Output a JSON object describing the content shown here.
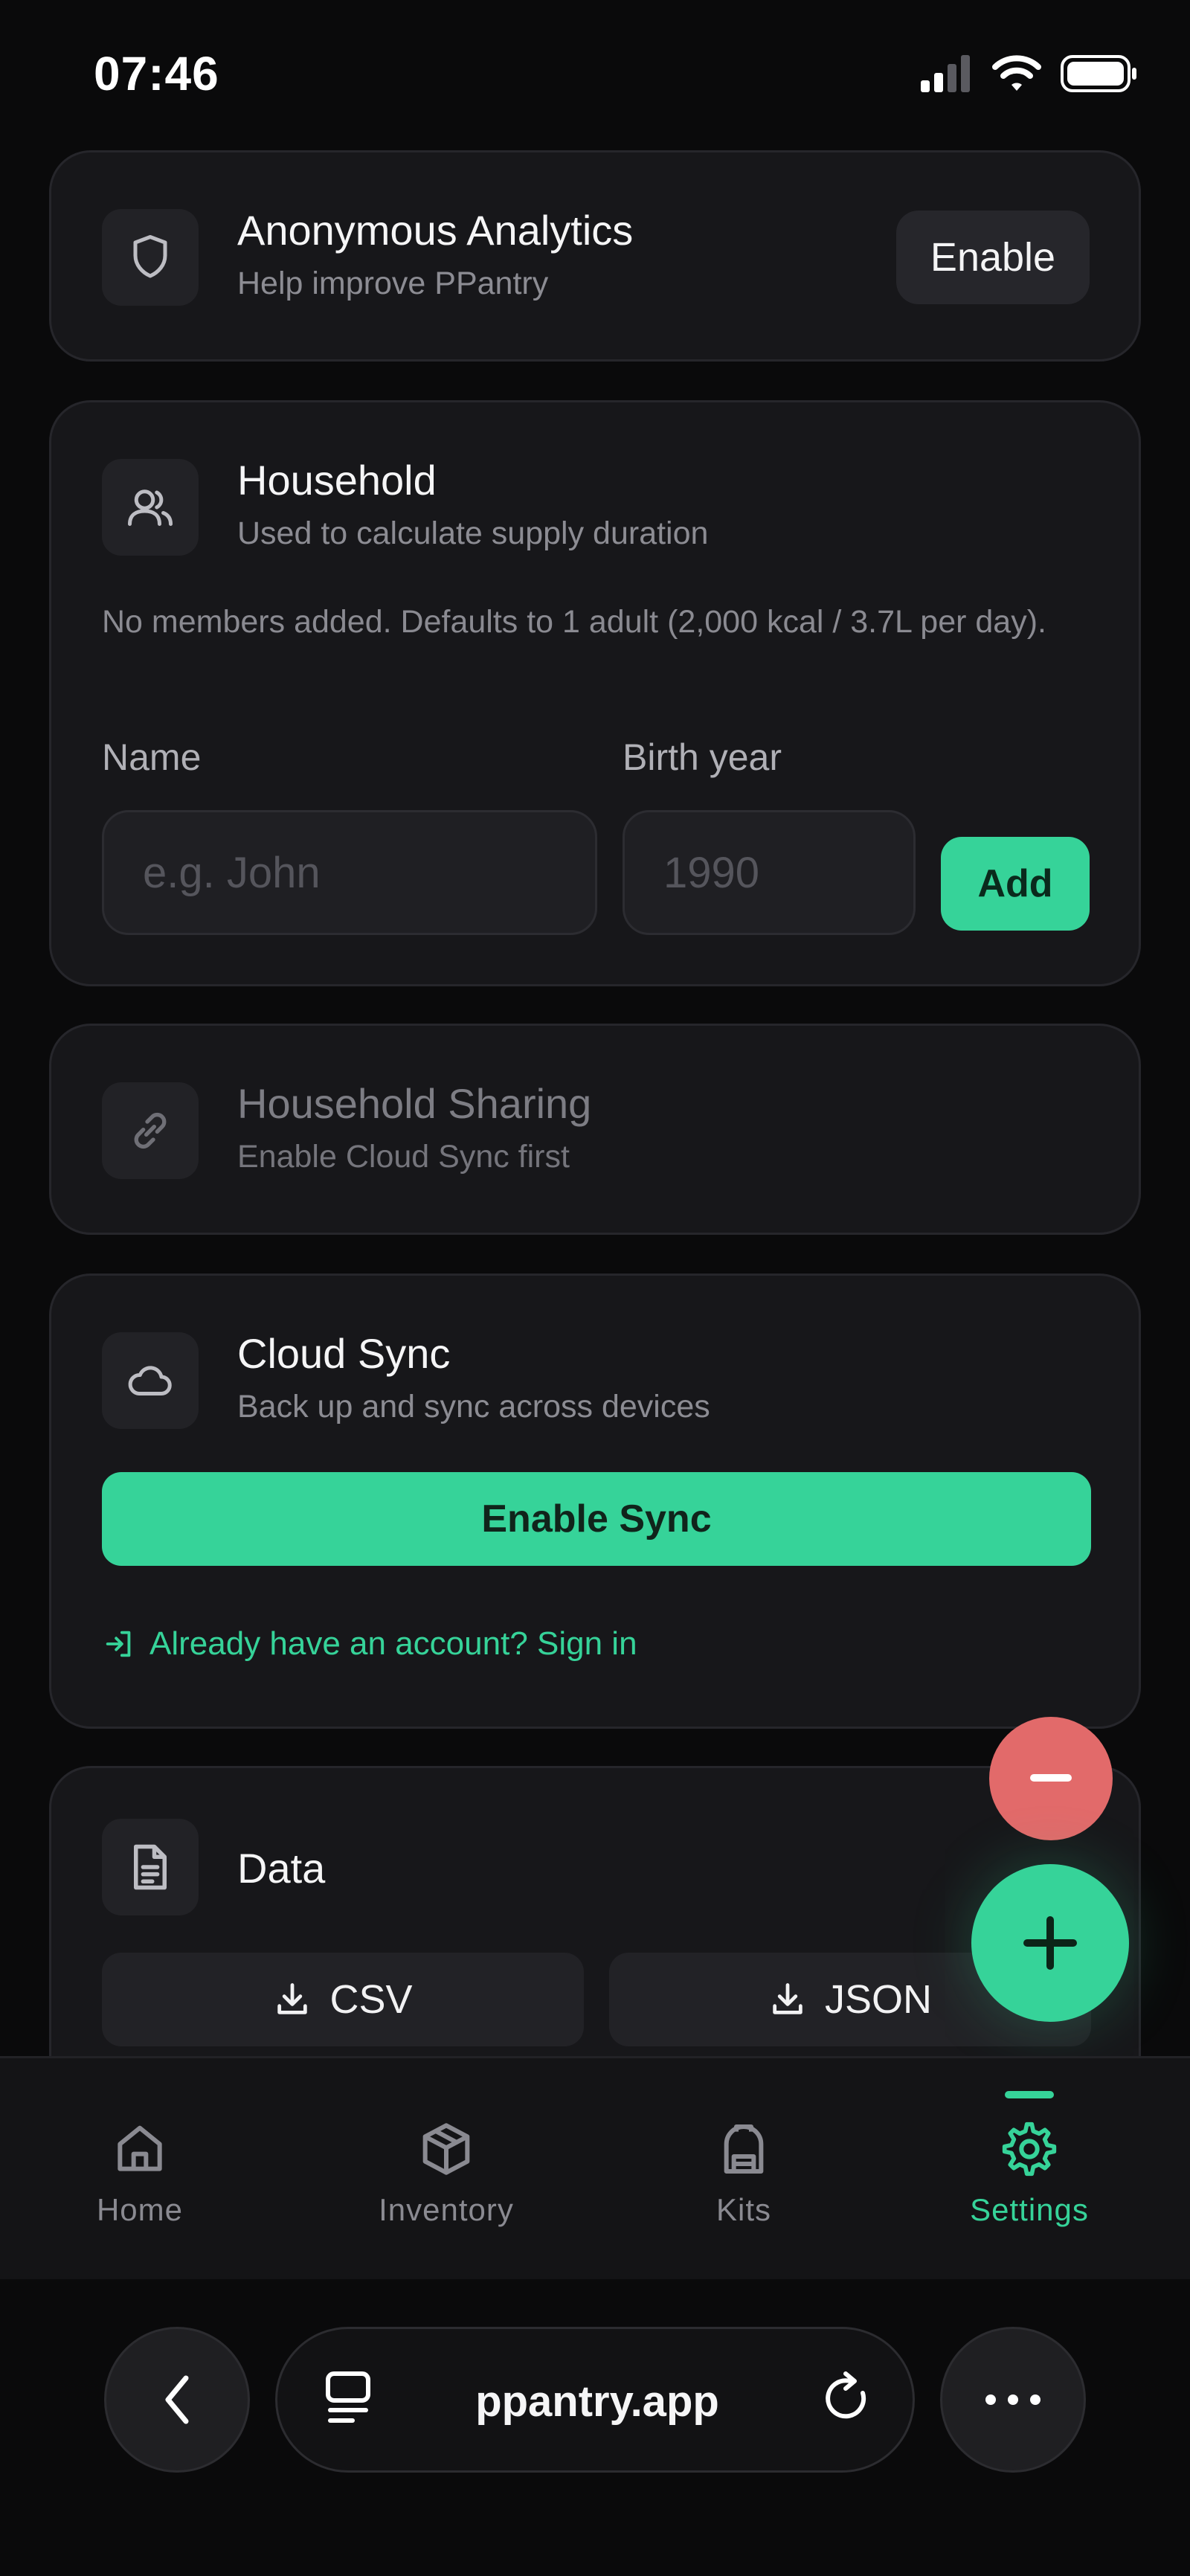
{
  "status_bar": {
    "time": "07:46"
  },
  "analytics": {
    "title": "Anonymous Analytics",
    "subtitle": "Help improve PPantry",
    "button_label": "Enable"
  },
  "household": {
    "title": "Household",
    "subtitle": "Used to calculate supply duration",
    "note": "No members added. Defaults to 1 adult (2,000 kcal / 3.7L per day).",
    "name_label": "Name",
    "name_placeholder": "e.g. John",
    "birth_label": "Birth year",
    "birth_placeholder": "1990",
    "add_label": "Add"
  },
  "sharing": {
    "title": "Household Sharing",
    "subtitle": "Enable Cloud Sync first"
  },
  "cloud_sync": {
    "title": "Cloud Sync",
    "subtitle": "Back up and sync across devices",
    "enable_label": "Enable Sync",
    "signin_label": "Already have an account? Sign in"
  },
  "data_section": {
    "title": "Data",
    "csv_label": "CSV",
    "json_label": "JSON"
  },
  "nav": {
    "items": [
      {
        "label": "Home",
        "icon": "home-icon",
        "active": false
      },
      {
        "label": "Inventory",
        "icon": "box-icon",
        "active": false
      },
      {
        "label": "Kits",
        "icon": "backpack-icon",
        "active": false
      },
      {
        "label": "Settings",
        "icon": "gear-icon",
        "active": true
      }
    ]
  },
  "browser": {
    "url": "ppantry.app"
  },
  "colors": {
    "accent": "#36d399",
    "danger": "#e26a6a",
    "card": "#17171a",
    "background": "#0a0a0b"
  }
}
